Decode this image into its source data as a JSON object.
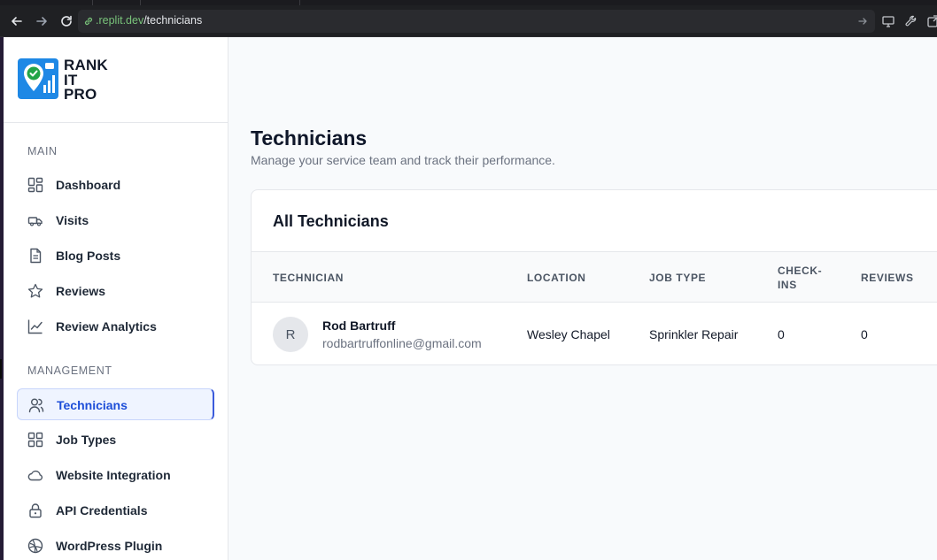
{
  "browser": {
    "url_host": ".replit.dev",
    "url_path": "/technicians"
  },
  "brand": {
    "logo_lines": [
      "RANK",
      "IT",
      "PRO"
    ]
  },
  "sidebar": {
    "main_label": "MAIN",
    "main_items": [
      {
        "label": "Dashboard",
        "icon": "dashboard-grid-icon"
      },
      {
        "label": "Visits",
        "icon": "truck-icon"
      },
      {
        "label": "Blog Posts",
        "icon": "document-icon"
      },
      {
        "label": "Reviews",
        "icon": "star-icon"
      },
      {
        "label": "Review Analytics",
        "icon": "line-chart-icon"
      }
    ],
    "management_label": "MANAGEMENT",
    "management_items": [
      {
        "label": "Technicians",
        "icon": "users-icon",
        "active": true
      },
      {
        "label": "Job Types",
        "icon": "grid-icon"
      },
      {
        "label": "Website Integration",
        "icon": "cloud-icon"
      },
      {
        "label": "API Credentials",
        "icon": "lock-icon"
      },
      {
        "label": "WordPress Plugin",
        "icon": "wordpress-icon"
      }
    ]
  },
  "page": {
    "title": "Technicians",
    "subtitle": "Manage your service team and track their performance."
  },
  "card": {
    "title": "All Technicians",
    "columns": [
      "TECHNICIAN",
      "LOCATION",
      "JOB TYPE",
      "CHECK-\nINS",
      "REVIEWS"
    ],
    "rows": [
      {
        "initial": "R",
        "name": "Rod Bartruff",
        "email": "rodbartruffonline@gmail.com",
        "location": "Wesley Chapel",
        "job_type": "Sprinkler Repair",
        "check_ins": "0",
        "reviews": "0"
      }
    ]
  },
  "colors": {
    "accent": "#1d4ed8",
    "active_bg": "#eff4ff",
    "url_host": "#79c37a"
  }
}
